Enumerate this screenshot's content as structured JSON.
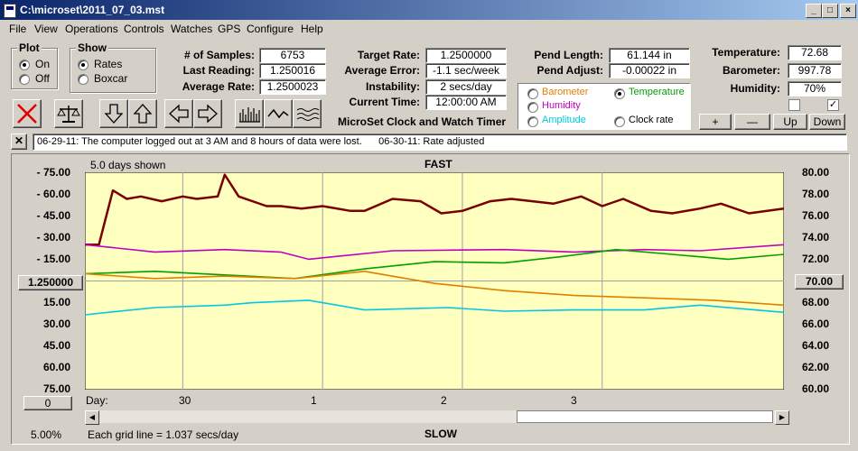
{
  "window": {
    "title": "C:\\microset\\2011_07_03.mst"
  },
  "menu": [
    "File",
    "View",
    "Operations",
    "Controls",
    "Watches",
    "GPS",
    "Configure",
    "Help"
  ],
  "plot_group": {
    "title": "Plot",
    "options": [
      "On",
      "Off"
    ],
    "selected": "On"
  },
  "show_group": {
    "title": "Show",
    "options": [
      "Rates",
      "Boxcar"
    ],
    "selected": "Rates"
  },
  "stats": {
    "samples_label": "# of Samples:",
    "samples": "6753",
    "last_reading_label": "Last Reading:",
    "last_reading": "1.250016",
    "average_rate_label": "Average Rate:",
    "average_rate": "1.2500023"
  },
  "rates": {
    "target_rate_label": "Target Rate:",
    "target_rate": "1.2500000",
    "average_error_label": "Average Error:",
    "average_error": "-1.1 sec/week",
    "instability_label": "Instability:",
    "instability": "2 secs/day",
    "current_time_label": "Current Time:",
    "current_time": "12:00:00 AM"
  },
  "app_title": "MicroSet Clock and Watch Timer",
  "pendulum": {
    "length_label": "Pend Length:",
    "length": "61.144 in",
    "adjust_label": "Pend Adjust:",
    "adjust": "-0.00022 in"
  },
  "sensors": {
    "temperature_label": "Temperature:",
    "temperature": "72.68",
    "barometer_label": "Barometer:",
    "barometer": "997.78",
    "humidity_label": "Humidity:",
    "humidity": "70%",
    "check1": false,
    "check2": true
  },
  "aux_select": {
    "options": [
      {
        "label": "Barometer",
        "color": "#e08000",
        "selected": false
      },
      {
        "label": "Temperature",
        "color": "#00a000",
        "selected": true
      },
      {
        "label": "Humidity",
        "color": "#c000c0",
        "selected": false
      },
      {
        "label": "Amplitude",
        "color": "#00c8e0",
        "selected": false
      },
      {
        "label": "Clock rate",
        "color": "#000000",
        "selected": false
      }
    ]
  },
  "scale_buttons": [
    "+",
    "—",
    "Up",
    "Down"
  ],
  "message": "06-29-11: The computer logged out at 3 AM and 8 hours of data were lost.      06-30-11: Rate adjusted",
  "chart": {
    "days_shown": "5.0 days shown",
    "top_label": "FAST",
    "bottom_label": "SLOW",
    "center_value": "1.250000",
    "right_center_value": "70.00",
    "zero_button": "0",
    "zoom": "5.00%",
    "grid_note": "Each grid line = 1.037 secs/day",
    "day_label": "Day:",
    "left_labels": [
      "- 75.00",
      "- 60.00",
      "- 45.00",
      "- 30.00",
      "- 15.00",
      "15.00",
      "30.00",
      "45.00",
      "60.00",
      "75.00"
    ],
    "right_labels": [
      "80.00",
      "78.00",
      "76.00",
      "74.00",
      "72.00",
      "68.00",
      "66.00",
      "64.00",
      "62.00",
      "60.00"
    ],
    "day_ticks": [
      "30",
      "1",
      "2",
      "3"
    ]
  },
  "chart_data": {
    "type": "line",
    "title": "",
    "xlabel": "Day:",
    "x_ticks": [
      "30",
      "1",
      "2",
      "3"
    ],
    "xlim": [
      0,
      5
    ],
    "ylim_left": [
      -90,
      90
    ],
    "ylim_right": [
      60,
      80
    ],
    "series": [
      {
        "color": "#7a0000",
        "x": [
          0,
          0.1,
          0.2,
          0.3,
          0.4,
          0.55,
          0.7,
          0.8,
          0.95,
          1.0,
          1.1,
          1.3,
          1.4,
          1.55,
          1.7,
          1.9,
          2.0,
          2.2,
          2.4,
          2.55,
          2.7,
          2.9,
          3.05,
          3.2,
          3.35,
          3.55,
          3.7,
          3.85,
          4.05,
          4.2,
          4.4,
          4.55,
          4.75,
          5.0
        ],
        "y": [
          -30,
          -30,
          -75,
          -68,
          -70,
          -66,
          -70,
          -68,
          -70,
          -88,
          -70,
          -62,
          -62,
          -60,
          -62,
          -58,
          -58,
          -68,
          -66,
          -56,
          -58,
          -66,
          -68,
          -66,
          -64,
          -70,
          -62,
          -68,
          -58,
          -56,
          -60,
          -64,
          -56,
          -60
        ]
      },
      {
        "color": "#c000c0",
        "x": [
          0,
          0.5,
          1.0,
          1.4,
          1.6,
          2.2,
          3.0,
          3.5,
          4.0,
          4.4,
          5.0
        ],
        "y": [
          -30,
          -24,
          -26,
          -24,
          -18,
          -25,
          -26,
          -24,
          -26,
          -25,
          -30
        ]
      },
      {
        "color": "#00a000",
        "x": [
          0,
          0.5,
          1.0,
          1.5,
          2.0,
          2.5,
          3.0,
          3.4,
          3.8,
          4.2,
          4.6,
          5.0
        ],
        "y": [
          -6,
          -8,
          -5,
          -2,
          -10,
          -16,
          -15,
          -20,
          -26,
          -22,
          -18,
          -22
        ]
      },
      {
        "color": "#e08000",
        "x": [
          0,
          0.5,
          1.0,
          1.5,
          2.0,
          2.5,
          3.0,
          3.5,
          4.0,
          4.5,
          5.0
        ],
        "y": [
          -6,
          -2,
          -4,
          -2,
          -8,
          2,
          8,
          12,
          14,
          16,
          20
        ]
      },
      {
        "color": "#00c8e0",
        "x": [
          0,
          0.5,
          1.0,
          1.2,
          1.6,
          2.0,
          2.6,
          3.0,
          3.5,
          4.0,
          4.4,
          5.0
        ],
        "y": [
          28,
          22,
          20,
          18,
          16,
          24,
          22,
          25,
          24,
          24,
          20,
          26
        ]
      }
    ]
  }
}
